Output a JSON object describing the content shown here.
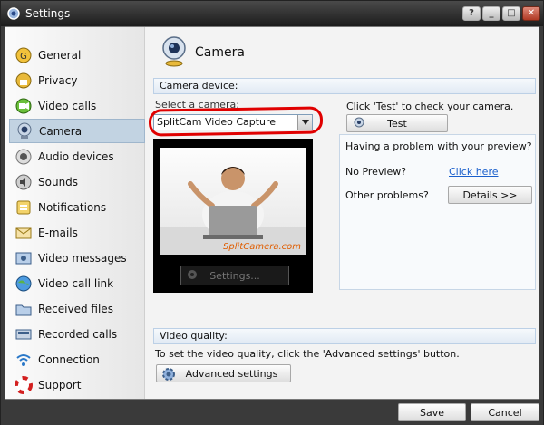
{
  "window": {
    "title": "Settings",
    "controls": {
      "help": "?",
      "minimize": "_",
      "maximize": "□",
      "close": "✕"
    }
  },
  "sidebar": {
    "items": [
      {
        "label": "General",
        "icon": "general-icon"
      },
      {
        "label": "Privacy",
        "icon": "privacy-icon"
      },
      {
        "label": "Video calls",
        "icon": "video-calls-icon"
      },
      {
        "label": "Camera",
        "icon": "webcam-icon",
        "selected": true
      },
      {
        "label": "Audio devices",
        "icon": "speaker-icon"
      },
      {
        "label": "Sounds",
        "icon": "sounds-icon"
      },
      {
        "label": "Notifications",
        "icon": "notifications-icon"
      },
      {
        "label": "E-mails",
        "icon": "email-icon"
      },
      {
        "label": "Video messages",
        "icon": "video-messages-icon"
      },
      {
        "label": "Video call link",
        "icon": "globe-icon"
      },
      {
        "label": "Received files",
        "icon": "folder-icon"
      },
      {
        "label": "Recorded calls",
        "icon": "recorded-calls-icon"
      },
      {
        "label": "Connection",
        "icon": "connection-icon"
      },
      {
        "label": "Support",
        "icon": "lifebuoy-icon"
      }
    ]
  },
  "page": {
    "title": "Camera"
  },
  "camera_device": {
    "header": "Camera device:",
    "select_label": "Select a camera:",
    "selected_camera": "SplitCam Video Capture",
    "test_hint": "Click 'Test' to check your camera.",
    "test_button": "Test",
    "preview_watermark": "SplitCamera.com",
    "settings_button": "Settings..."
  },
  "problems": {
    "title": "Having a problem with your preview?",
    "no_preview_label": "No Preview?",
    "no_preview_link": "Click here",
    "other_label": "Other problems?",
    "details_button": "Details >>"
  },
  "video_quality": {
    "header": "Video quality:",
    "description": "To set the video quality, click the 'Advanced settings' button.",
    "advanced_button": "Advanced settings"
  },
  "footer": {
    "save": "Save",
    "cancel": "Cancel"
  },
  "colors": {
    "selection": "#c2d3e2",
    "link": "#1a5fcc",
    "highlight_ring": "#e00000",
    "section_header": "#e1eaf4"
  }
}
